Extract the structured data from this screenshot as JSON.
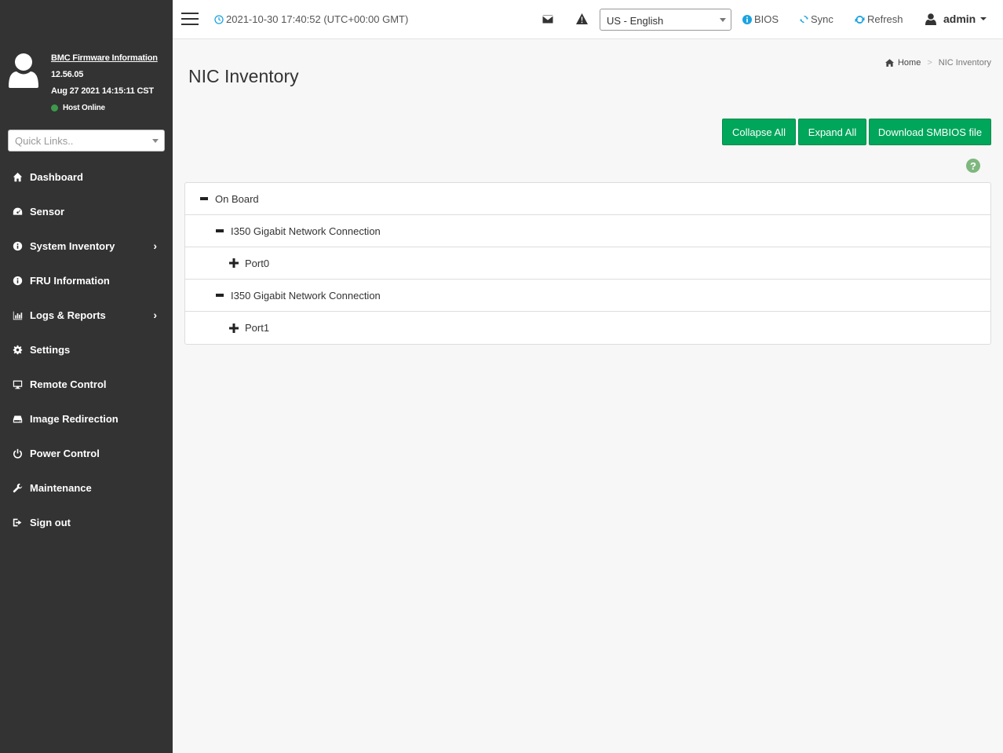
{
  "sidebar": {
    "firmware_link": "BMC Firmware Information",
    "firmware_version": "12.56.05",
    "firmware_date": "Aug 27 2021 14:15:11 CST",
    "host_status": "Host Online",
    "quick_links_placeholder": "Quick Links..",
    "items": [
      {
        "label": "Dashboard",
        "icon": "home-icon"
      },
      {
        "label": "Sensor",
        "icon": "gauge-icon"
      },
      {
        "label": "System Inventory",
        "icon": "info-icon",
        "has_submenu": true
      },
      {
        "label": "FRU Information",
        "icon": "info-icon"
      },
      {
        "label": "Logs & Reports",
        "icon": "bar-chart-icon",
        "has_submenu": true
      },
      {
        "label": "Settings",
        "icon": "gear-icon"
      },
      {
        "label": "Remote Control",
        "icon": "monitor-icon"
      },
      {
        "label": "Image Redirection",
        "icon": "drive-icon"
      },
      {
        "label": "Power Control",
        "icon": "power-icon"
      },
      {
        "label": "Maintenance",
        "icon": "wrench-icon"
      },
      {
        "label": "Sign out",
        "icon": "sign-out-icon"
      }
    ]
  },
  "topbar": {
    "datetime": "2021-10-30 17:40:52 (UTC+00:00 GMT)",
    "language": "US - English",
    "bios_label": "BIOS",
    "sync_label": "Sync",
    "refresh_label": "Refresh",
    "user": "admin"
  },
  "page": {
    "title": "NIC Inventory",
    "breadcrumb_home": "Home",
    "breadcrumb_current": "NIC Inventory",
    "collapse_all": "Collapse All",
    "expand_all": "Expand All",
    "download_smbios": "Download SMBIOS file"
  },
  "tree": [
    {
      "label": "On Board",
      "level": 0,
      "state": "expanded"
    },
    {
      "label": "I350 Gigabit Network Connection",
      "level": 1,
      "state": "expanded"
    },
    {
      "label": "Port0",
      "level": 2,
      "state": "collapsed"
    },
    {
      "label": "I350 Gigabit Network Connection",
      "level": 1,
      "state": "expanded"
    },
    {
      "label": "Port1",
      "level": 2,
      "state": "collapsed"
    }
  ],
  "colors": {
    "sidebar_bg": "#333333",
    "button_green": "#00a65a",
    "host_online": "#3c9a4a",
    "topbar_icon_blue": "#1aa3e0"
  }
}
